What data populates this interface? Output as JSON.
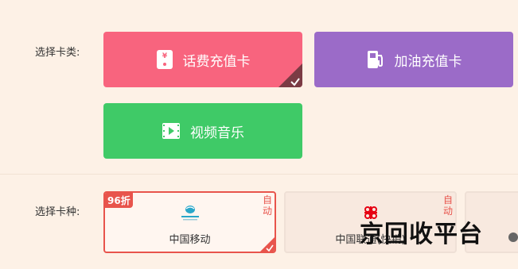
{
  "card_type_section": {
    "label": "选择卡类:",
    "cards": [
      {
        "label": "话费充值卡",
        "icon": "phone-card-icon",
        "color": "#f8647e",
        "selected": true
      },
      {
        "label": "加油充值卡",
        "icon": "fuel-pump-icon",
        "color": "#9b6bc8",
        "selected": false
      },
      {
        "label": "视频音乐",
        "icon": "video-film-icon",
        "color": "#3fca67",
        "selected": false
      }
    ]
  },
  "card_kind_section": {
    "label": "选择卡种:",
    "operators": [
      {
        "name": "中国移动",
        "discount": "96折",
        "auto": "自动",
        "selected": true,
        "logo": "china-mobile-logo"
      },
      {
        "name": "中国联通(快销)",
        "auto": "自动",
        "selected": false,
        "logo": "china-unicom-logo"
      }
    ]
  },
  "watermark": "京回收平台",
  "colors": {
    "accent_red": "#e8544c",
    "background": "#fdf1e6"
  }
}
